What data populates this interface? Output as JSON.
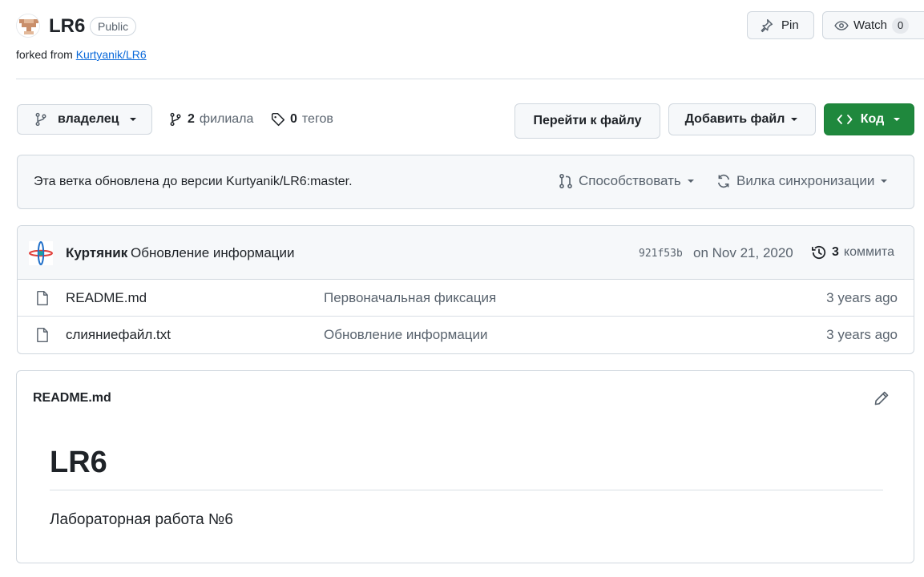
{
  "repo": {
    "name": "LR6",
    "visibility": "Public",
    "forked_prefix": "forked from",
    "forked_from": "Kurtyanik/LR6"
  },
  "actions": {
    "pin_label": "Pin",
    "watch_label": "Watch",
    "watch_count": "0"
  },
  "toolbar": {
    "branch_name": "владелец",
    "branches_count": "2",
    "branches_label": "филиала",
    "tags_count": "0",
    "tags_label": "тегов",
    "goto_file_label": "Перейти к файлу",
    "add_file_label": "Добавить файл",
    "code_label": "Код"
  },
  "banner": {
    "text": "Эта ветка обновлена до версии Kurtyanik/LR6:master.",
    "contribute_label": "Способствовать",
    "sync_label": "Вилка синхронизации"
  },
  "latest_commit": {
    "author": "Куртяник",
    "message": "Обновление информации",
    "hash": "921f53b",
    "date": "on Nov 21, 2020",
    "commits_count": "3",
    "commits_label": "коммита"
  },
  "files": [
    {
      "name": "README.md",
      "message": "Первоначальная фиксация",
      "age": "3 years ago"
    },
    {
      "name": "слияниефайл.txt",
      "message": "Обновление информации",
      "age": "3 years ago"
    }
  ],
  "readme": {
    "filename": "README.md",
    "heading": "LR6",
    "body": "Лабораторная работа №6"
  },
  "colors": {
    "accent": "#0969da",
    "code_button": "#1f883d",
    "border": "#d0d7de",
    "muted_text": "#59636e"
  },
  "icons": [
    "avatar-identicon",
    "pin-icon",
    "eye-icon",
    "branch-icon",
    "tag-icon",
    "code-icon",
    "pull-request-icon",
    "sync-icon",
    "history-icon",
    "file-icon",
    "pencil-icon"
  ]
}
